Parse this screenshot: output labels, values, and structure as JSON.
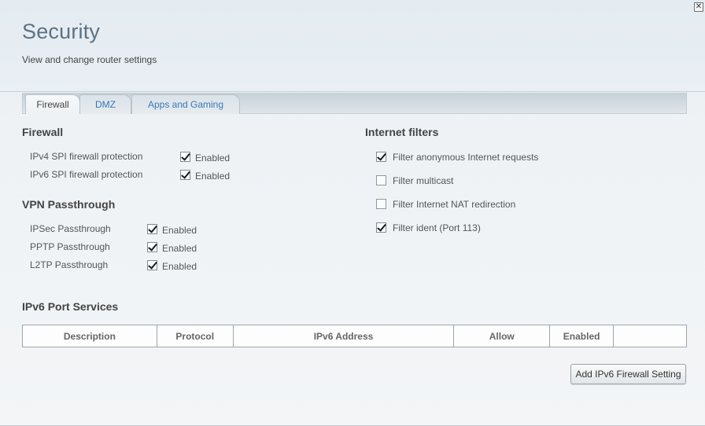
{
  "header": {
    "title": "Security",
    "subtitle": "View and change router settings"
  },
  "tabs": [
    {
      "label": "Firewall",
      "active": true
    },
    {
      "label": "DMZ",
      "active": false
    },
    {
      "label": "Apps and Gaming",
      "active": false
    }
  ],
  "firewall": {
    "title": "Firewall",
    "rows": [
      {
        "label": "IPv4 SPI firewall protection",
        "checkbox_label": "Enabled",
        "checked": true
      },
      {
        "label": "IPv6 SPI firewall protection",
        "checkbox_label": "Enabled",
        "checked": true
      }
    ]
  },
  "vpn": {
    "title": "VPN Passthrough",
    "rows": [
      {
        "label": "IPSec Passthrough",
        "checkbox_label": "Enabled",
        "checked": true
      },
      {
        "label": "PPTP Passthrough",
        "checkbox_label": "Enabled",
        "checked": true
      },
      {
        "label": "L2TP Passthrough",
        "checkbox_label": "Enabled",
        "checked": true
      }
    ]
  },
  "internet_filters": {
    "title": "Internet filters",
    "items": [
      {
        "label": "Filter anonymous Internet requests",
        "checked": true
      },
      {
        "label": "Filter multicast",
        "checked": false
      },
      {
        "label": "Filter Internet NAT redirection",
        "checked": false
      },
      {
        "label": "Filter ident (Port 113)",
        "checked": true
      }
    ]
  },
  "ipv6_ports": {
    "title": "IPv6 Port Services",
    "columns": [
      "Description",
      "Protocol",
      "IPv6 Address",
      "Allow",
      "Enabled",
      ""
    ],
    "add_button": "Add IPv6 Firewall Setting"
  },
  "icons": {
    "close": "close-icon"
  }
}
